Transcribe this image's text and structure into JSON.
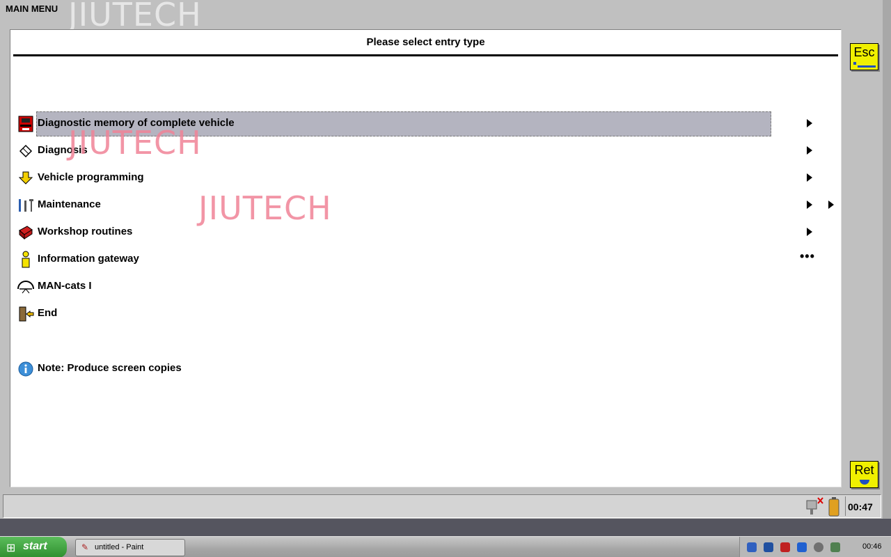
{
  "title": "MAIN MENU",
  "watermark": "JIUTECH",
  "panel": {
    "heading": "Please select entry type"
  },
  "menu": [
    {
      "label": "Diagnostic memory of complete vehicle",
      "icon": "vehicle-diagnostic-icon",
      "indicator": "arrow",
      "selected": true
    },
    {
      "label": "Diagnosis",
      "icon": "eraser-icon",
      "indicator": "arrow"
    },
    {
      "label": "Vehicle programming",
      "icon": "download-arrow-icon",
      "indicator": "arrow"
    },
    {
      "label": "Maintenance",
      "icon": "tools-icon",
      "indicator": "double-arrow"
    },
    {
      "label": "Workshop routines",
      "icon": "toolbox-icon",
      "indicator": "arrow"
    },
    {
      "label": "Information gateway",
      "icon": "info-person-icon",
      "indicator": "dots"
    },
    {
      "label": "MAN-cats I",
      "icon": "man-logo-icon",
      "indicator": "none"
    },
    {
      "label": "End",
      "icon": "exit-door-icon",
      "indicator": "none"
    }
  ],
  "note": {
    "label": "Note: Produce screen copies",
    "icon": "info-icon"
  },
  "indicators": {
    "dots": "•••"
  },
  "buttons": {
    "esc": "Esc",
    "ret": "Ret"
  },
  "status": {
    "time": "00:47"
  },
  "taskbar": {
    "start": "start",
    "task": "untitled - Paint",
    "clock": "00:46"
  },
  "colors": {
    "highlight": "#b4b4c0",
    "button": "#f0f000",
    "watermark": "#f08296"
  }
}
